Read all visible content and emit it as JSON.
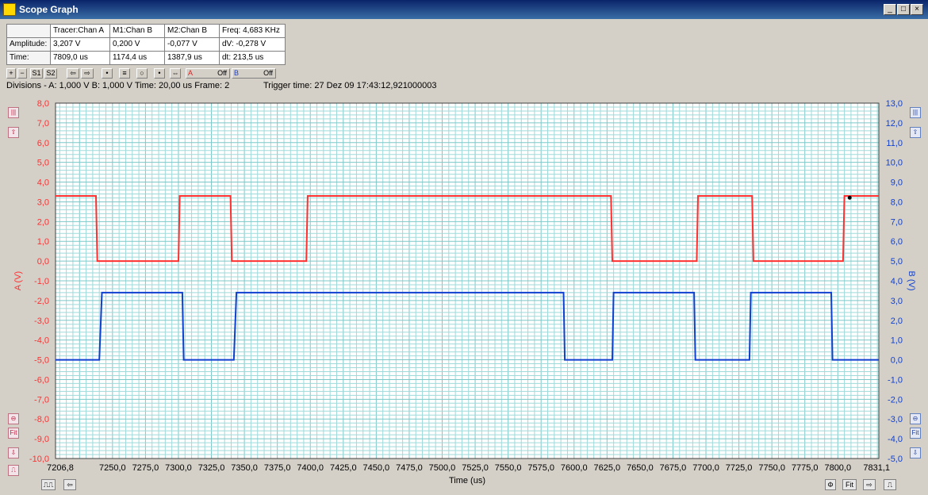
{
  "window": {
    "title": "Scope Graph",
    "min": "_",
    "max": "□",
    "close": "×"
  },
  "info": {
    "row0": [
      "",
      "Tracer:Chan A",
      "M1:Chan B",
      "M2:Chan B",
      "Freq: 4,683 KHz"
    ],
    "row1": [
      "Amplitude:",
      "3,207 V",
      "0,200 V",
      "-0,077 V",
      "dV: -0,278 V"
    ],
    "row2": [
      "Time:",
      "7809,0 us",
      "1174,4 us",
      "1387,9 us",
      "dt:  213,5 us"
    ]
  },
  "toolbar": {
    "s1": "S1",
    "s2": "S2",
    "a_label": "A",
    "a_off": "Off",
    "b_label": "B",
    "b_off": "Off",
    "plus": "+",
    "minus": "−",
    "left": "⇦",
    "right": "⇨"
  },
  "status": {
    "divisions": "Divisions -  A: 1,000 V   B: 1,000 V   Time: 20,00 us  Frame: 2",
    "trigger": "Trigger time: 27 Dez 09 17:43:12,921000003"
  },
  "side": {
    "fit": "Fit",
    "fit_bottom": "Fit"
  },
  "colors": {
    "chanA": "#ff3030",
    "chanB": "#1040d0",
    "grid": "#9fdada",
    "gridMajor": "#7cc8c8"
  },
  "chart_data": {
    "type": "line",
    "xlabel": "Time (us)",
    "ylabel_left": "A (V)",
    "ylabel_right": "B (V)",
    "xlim": [
      7206.8,
      7831.1
    ],
    "ylim_left": [
      -10.0,
      8.0
    ],
    "ylim_right": [
      -5.0,
      13.0
    ],
    "x_ticks": [
      "7206,8",
      "7250,0",
      "7275,0",
      "7300,0",
      "7325,0",
      "7350,0",
      "7375,0",
      "7400,0",
      "7425,0",
      "7450,0",
      "7475,0",
      "7500,0",
      "7525,0",
      "7550,0",
      "7575,0",
      "7600,0",
      "7625,0",
      "7650,0",
      "7675,0",
      "7700,0",
      "7725,0",
      "7750,0",
      "7775,0",
      "7800,0",
      "7831,1"
    ],
    "y_left_ticks": [
      "8,0",
      "7,0",
      "6,0",
      "5,0",
      "4,0",
      "3,0",
      "2,0",
      "1,0",
      "0,0",
      "-1,0",
      "-2,0",
      "-3,0",
      "-4,0",
      "-5,0",
      "-6,0",
      "-7,0",
      "-8,0",
      "-9,0",
      "-10,0"
    ],
    "y_right_ticks": [
      "13,0",
      "12,0",
      "11,0",
      "10,0",
      "9,0",
      "8,0",
      "7,0",
      "6,0",
      "5,0",
      "4,0",
      "3,0",
      "2,0",
      "1,0",
      "0,0",
      "-1,0",
      "-2,0",
      "-3,0",
      "-4,0",
      "-5,0"
    ],
    "series": [
      {
        "name": "Chan A",
        "axis": "left",
        "x": [
          7206.8,
          7237.5,
          7238.5,
          7300.0,
          7301.0,
          7339.5,
          7340.5,
          7397.0,
          7398.0,
          7628.0,
          7629.0,
          7693.0,
          7694.0,
          7735.0,
          7736.0,
          7804.0,
          7805.0,
          7831.1
        ],
        "y": [
          3.3,
          3.3,
          0.0,
          0.0,
          3.3,
          3.3,
          0.0,
          0.0,
          3.3,
          3.3,
          0.0,
          0.0,
          3.3,
          3.3,
          0.0,
          0.0,
          3.3,
          3.3
        ]
      },
      {
        "name": "Chan B",
        "axis": "right",
        "x": [
          7206.8,
          7240.0,
          7242.0,
          7303.0,
          7304.0,
          7342.0,
          7344.0,
          7592.0,
          7593.0,
          7629.0,
          7630.0,
          7691.0,
          7692.0,
          7733.0,
          7734.0,
          7795.0,
          7796.0,
          7831.1
        ],
        "y": [
          0.0,
          0.0,
          3.4,
          3.4,
          0.0,
          0.0,
          3.4,
          3.4,
          0.0,
          0.0,
          3.4,
          3.4,
          0.0,
          0.0,
          3.4,
          3.4,
          0.0,
          0.0
        ]
      }
    ]
  }
}
